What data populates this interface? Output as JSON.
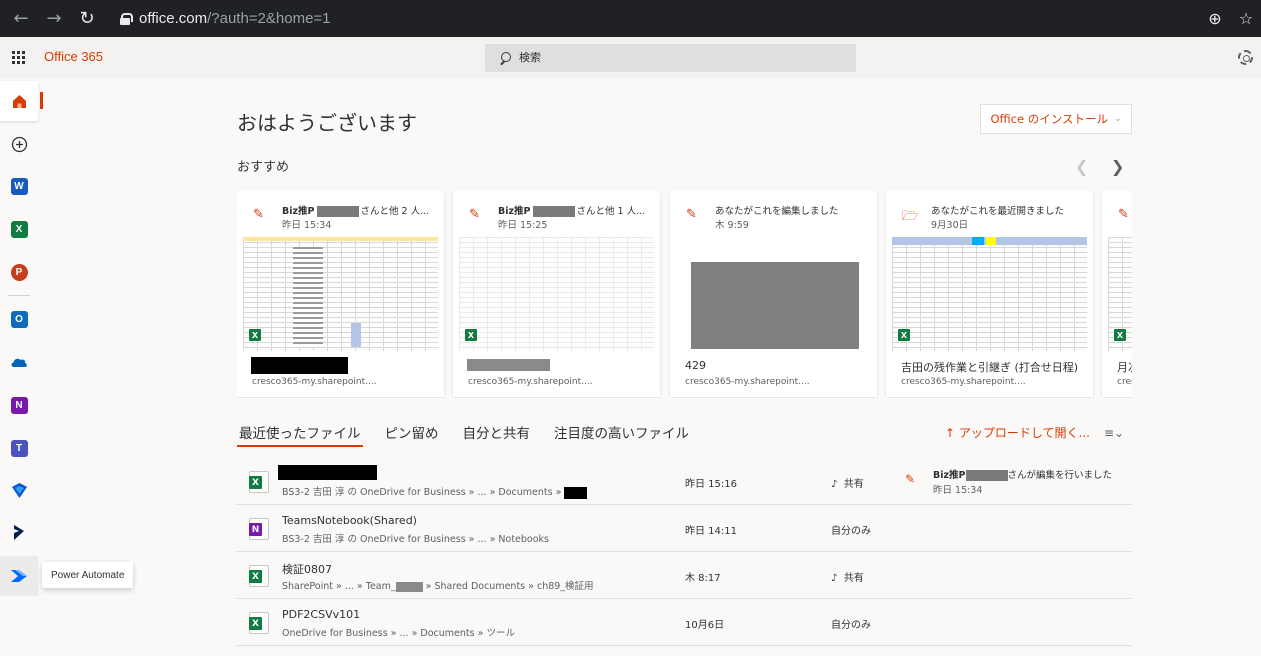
{
  "browser": {
    "url_host": "office.com",
    "url_rest": "/?auth=2&home=1"
  },
  "suite": {
    "brand": "Office 365",
    "search_placeholder": "検索"
  },
  "rail": {
    "tooltip": "Power Automate",
    "apps": [
      "home-icon",
      "create-icon",
      "word-icon",
      "excel-icon",
      "powerpoint-icon",
      "outlook-icon",
      "onedrive-icon",
      "onenote-icon",
      "teams-icon",
      "dynamics-icon",
      "dynamics365-icon",
      "power-automate-icon"
    ]
  },
  "main": {
    "greeting": "おはようございます",
    "install_label": "Office のインストール",
    "recommended_title": "おすすめ"
  },
  "cards": [
    {
      "who_pre": "Biz推P",
      "who_post": "さんと他 2 人...",
      "time": "昨日 15:34",
      "loc": "cresco365-my.sharepoint...."
    },
    {
      "who_pre": "Biz推P",
      "who_post": "さんと他 1 人...",
      "time": "昨日 15:25",
      "loc": "cresco365-my.sharepoint...."
    },
    {
      "who": "あなたがこれを編集しました",
      "time": "木 9:59",
      "name": "429",
      "loc": "cresco365-my.sharepoint...."
    },
    {
      "who": "あなたがこれを最近開きました",
      "time": "9月30日",
      "name": "吉田の残作業と引継ぎ (打合せ日程)",
      "loc": "cresco365-my.sharepoint...."
    },
    {
      "name": "月次",
      "loc": "cres"
    }
  ],
  "tabs": [
    "最近使ったファイル",
    "ピン留め",
    "自分と共有",
    "注目度の高いファイル"
  ],
  "toolbar": {
    "upload_label": "アップロードして開く..."
  },
  "files": [
    {
      "path_pre": "BS3-2 吉田 淳 の OneDrive for Business » ... » Documents »",
      "date": "昨日 15:16",
      "share": "共有",
      "activity_pre": "Biz推P",
      "activity_post": "さんが編集を行いました",
      "activity_time": "昨日 15:34"
    },
    {
      "name": "TeamsNotebook(Shared)",
      "path": "BS3-2 吉田 淳 の OneDrive for Business » ... » Notebooks",
      "date": "昨日 14:11",
      "share": "自分のみ"
    },
    {
      "name": "検証0807",
      "path_pre": "SharePoint » ... » Team_",
      "path_post": "» Shared Documents » ch89_検証用",
      "date": "木 8:17",
      "share": "共有"
    },
    {
      "name": "PDF2CSVv101",
      "path": "OneDrive for Business » ... » Documents » ツール",
      "date": "10月6日",
      "share": "自分のみ"
    }
  ]
}
